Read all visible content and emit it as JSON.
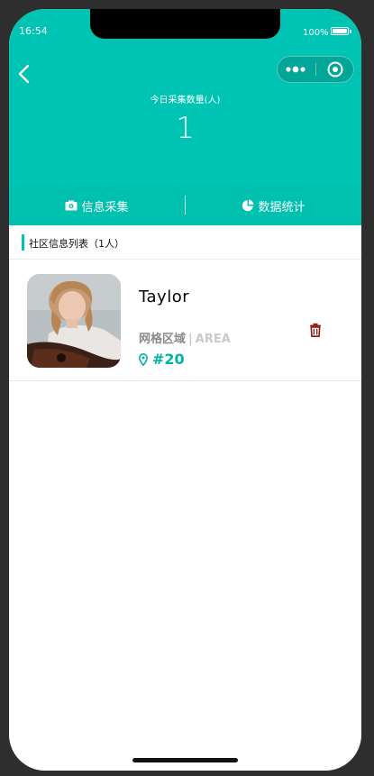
{
  "status_bar": {
    "time": "16:54",
    "battery": "100%"
  },
  "header": {
    "count_label": "今日采集数量(人)",
    "count_value": "1"
  },
  "tabs": [
    {
      "label": "信息采集",
      "icon": "camera-icon"
    },
    {
      "label": "数据统计",
      "icon": "pie-chart-icon"
    }
  ],
  "section": {
    "title": "社区信息列表（1人）"
  },
  "residents": [
    {
      "name": "Taylor",
      "area_label": "网格区域",
      "area_separator": "|",
      "area_code": "AREA",
      "number": "#20"
    }
  ],
  "colors": {
    "accent": "#00c4b3",
    "delete": "#8b1a0e"
  }
}
